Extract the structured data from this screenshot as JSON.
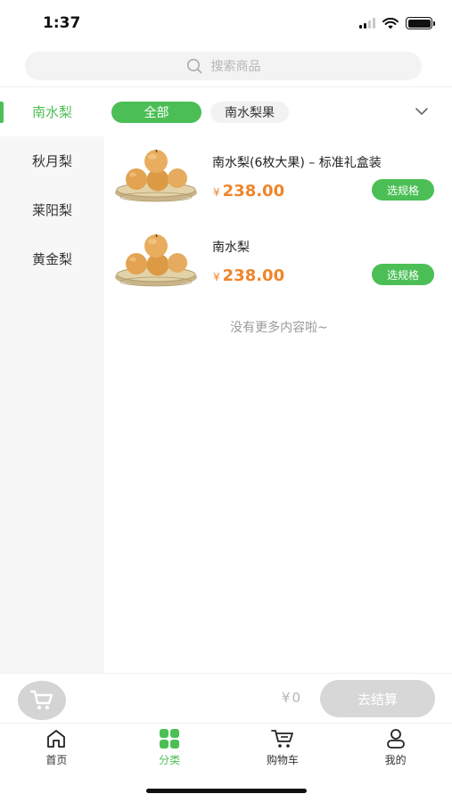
{
  "status_bar": {
    "time": "1:37"
  },
  "search": {
    "placeholder": "搜索商品",
    "icon": "search-icon"
  },
  "sidebar": {
    "items": [
      {
        "label": "南水梨",
        "active": true
      },
      {
        "label": "秋月梨",
        "active": false
      },
      {
        "label": "莱阳梨",
        "active": false
      },
      {
        "label": "黄金梨",
        "active": false
      }
    ]
  },
  "filters": {
    "chips": [
      {
        "label": "全部",
        "active": true
      },
      {
        "label": "南水梨果",
        "active": false
      }
    ],
    "expand_icon": "chevron-down-icon"
  },
  "products": [
    {
      "name": "南水梨(6枚大果) – 标准礼盒装",
      "currency": "¥",
      "price": "238.00",
      "button": "选规格"
    },
    {
      "name": "南水梨",
      "currency": "¥",
      "price": "238.00",
      "button": "选规格"
    }
  ],
  "list_end_note": "没有更多内容啦~",
  "cart": {
    "icon": "cart-icon",
    "currency": "¥",
    "total": "0",
    "checkout_label": "去结算"
  },
  "tab_bar": {
    "tabs": [
      {
        "label": "首页",
        "icon": "home-icon",
        "active": false
      },
      {
        "label": "分类",
        "icon": "category-icon",
        "active": true
      },
      {
        "label": "购物车",
        "icon": "cart-icon",
        "active": false
      },
      {
        "label": "我的",
        "icon": "profile-icon",
        "active": false
      }
    ]
  },
  "colors": {
    "accent": "#4bbf55",
    "price": "#f0852a",
    "disabled": "#d7d7d7"
  }
}
